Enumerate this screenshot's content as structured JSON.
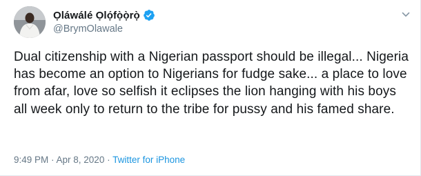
{
  "tweet": {
    "display_name": "Ọláwálé Ọlọ́fọ̀ọ̀rọ̀",
    "handle": "@BrymOlawale",
    "text": "Dual citizenship with a Nigerian passport should be illegal... Nigeria has become an option to Nigerians for fudge sake... a place to love from afar, love so selfish it eclipses the lion hanging with his boys all week only to return to the tribe for pussy and his famed share.",
    "timestamp": "9:49 PM · Apr 8, 2020",
    "separator": " · ",
    "source": "Twitter for iPhone"
  },
  "icons": {
    "avatar": "profile-photo",
    "verified": "verified-badge-icon",
    "menu": "chevron-down-icon"
  },
  "colors": {
    "primary_text": "#14171a",
    "secondary_text": "#657786",
    "link": "#1b95e0",
    "verified": "#1da1f2"
  }
}
